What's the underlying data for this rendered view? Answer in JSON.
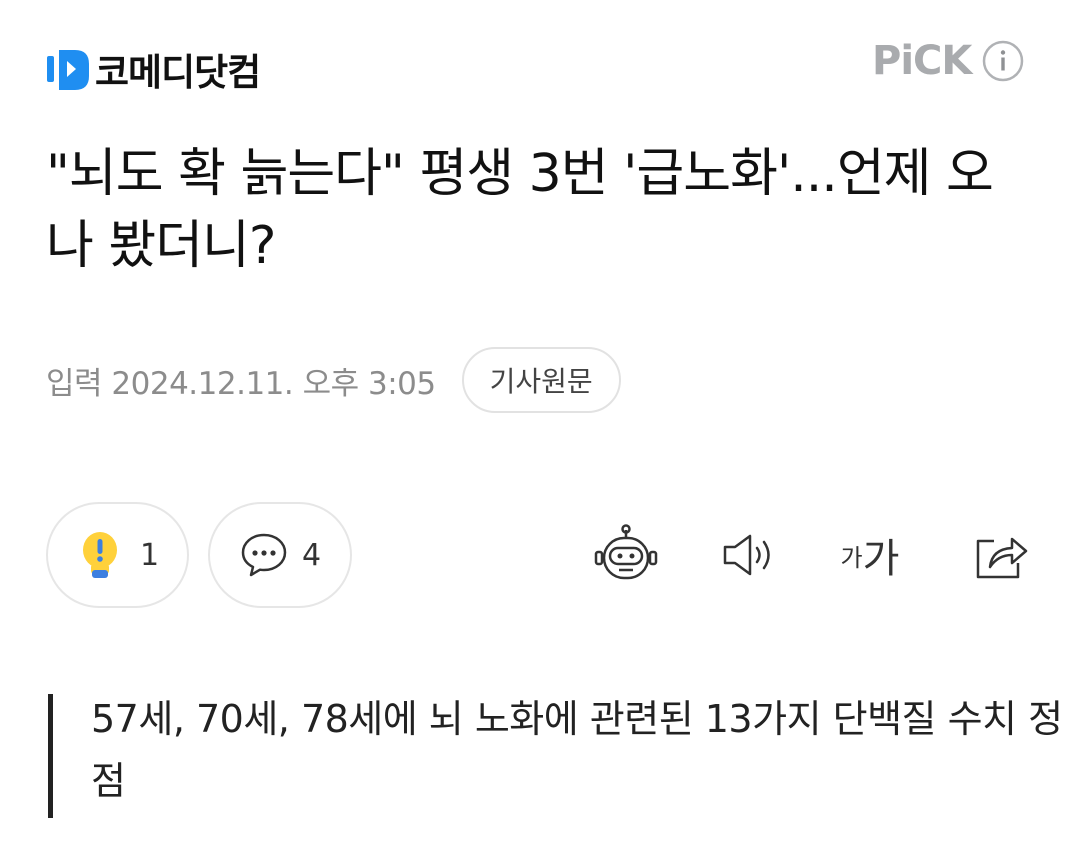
{
  "header": {
    "logo_text": "코메디닷컴",
    "pick_label": "PiCK",
    "icons": {
      "logo": "comedy-logo-icon",
      "info": "info-icon"
    },
    "colors": {
      "brand_blue": "#1f8ef1",
      "pick_gray": "#a9abae"
    }
  },
  "article": {
    "title": "\"뇌도 확 늙는다\" 평생 3번 '급노화'...언제 오나 봤더니?",
    "meta": {
      "date_label": "입력 2024.12.11. 오후 3:05",
      "original_button": "기사원문"
    },
    "reactions": [
      {
        "icon": "lightbulb-icon",
        "count": "1"
      },
      {
        "icon": "comment-icon",
        "count": "4"
      }
    ],
    "tools": {
      "summary_bot_icon": "robot-icon",
      "tts_icon": "speaker-icon",
      "font_size": {
        "small": "가",
        "large": "가"
      },
      "share_icon": "share-icon"
    },
    "summary": "57세, 70세, 78세에 뇌 노화에 관련된 13가지 단백질 수치 정점"
  }
}
